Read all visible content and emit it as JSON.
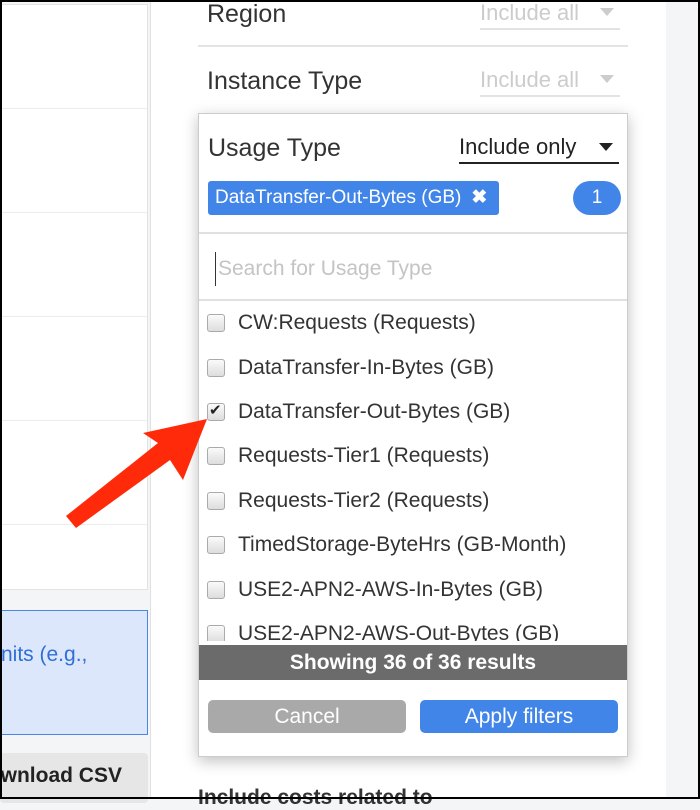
{
  "left": {
    "info_text": "nits (e.g.,",
    "download_label": "ownload CSV"
  },
  "filters": [
    {
      "label": "Region",
      "value": "Include all"
    },
    {
      "label": "Instance Type",
      "value": "Include all"
    }
  ],
  "bottom_text": "Include costs related to",
  "panel": {
    "title": "Usage Type",
    "mode": "Include only",
    "chip_label": "DataTransfer-Out-Bytes (GB)",
    "chip_remove": "✖",
    "selected_count": "1",
    "search_placeholder": "Search for Usage Type",
    "items": [
      {
        "label": "CW:Requests (Requests)",
        "checked": false
      },
      {
        "label": "DataTransfer-In-Bytes (GB)",
        "checked": false
      },
      {
        "label": "DataTransfer-Out-Bytes (GB)",
        "checked": true
      },
      {
        "label": "Requests-Tier1 (Requests)",
        "checked": false
      },
      {
        "label": "Requests-Tier2 (Requests)",
        "checked": false
      },
      {
        "label": "TimedStorage-ByteHrs (GB-Month)",
        "checked": false
      },
      {
        "label": "USE2-APN2-AWS-In-Bytes (GB)",
        "checked": false
      },
      {
        "label": "USE2-APN2-AWS-Out-Bytes (GB)",
        "checked": false
      }
    ],
    "status": "Showing 36 of 36 results",
    "cancel_label": "Cancel",
    "apply_label": "Apply filters"
  },
  "colors": {
    "accent": "#4285e8",
    "arrow": "#ff2a0a"
  }
}
